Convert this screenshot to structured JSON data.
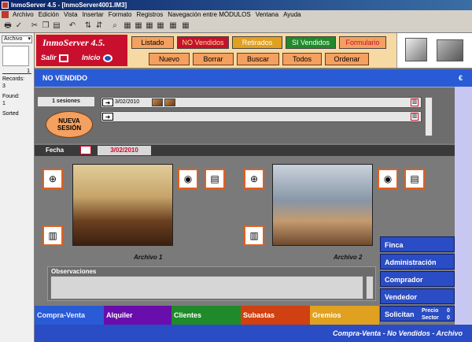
{
  "window": {
    "title": "InmoServer 4.5 - [InmoServer4001.IM3]"
  },
  "menu": [
    "Archivo",
    "Edición",
    "Vista",
    "Insertar",
    "Formato",
    "Registros",
    "Navegación entre MÓDULOS",
    "Ventana",
    "Ayuda"
  ],
  "status": {
    "layout_select": "Archivo",
    "record_number": "1",
    "records_label": "Records:",
    "records_value": "3",
    "found_label": "Found:",
    "found_value": "1",
    "sorted": "Sorted"
  },
  "logo": {
    "name": "InmoServer 4.5.",
    "salir": "Salir",
    "inicio": "Inicio"
  },
  "tabs": {
    "listado": "Listado",
    "no_vendidos": "NO Vendidos",
    "retirados": "Retirados",
    "si_vendidos": "SI Vendidos",
    "formulario": "Formulario"
  },
  "actions": {
    "nuevo": "Nuevo",
    "borrar": "Borrar",
    "buscar": "Buscar",
    "todos": "Todos",
    "ordenar": "Ordenar"
  },
  "section": {
    "title": "NO VENDIDO",
    "currency": "€"
  },
  "sessions": {
    "count_label": "1 sesiones",
    "new_label_1": "NUEVA",
    "new_label_2": "SESIÓN",
    "row1_date": "3/02/2010"
  },
  "fecha": {
    "label": "Fecha",
    "value": "3/02/2010"
  },
  "archivos": {
    "a1": "Archivo 1",
    "a2": "Archivo 2"
  },
  "observaciones": {
    "label": "Observaciones"
  },
  "side_buttons": {
    "finca": "Finca",
    "administracion": "Administración",
    "comprador": "Comprador",
    "vendedor": "Vendedor",
    "solicitan": "Solicitan",
    "precio_label": "Precio",
    "precio_value": "0",
    "sector_label": "Sector",
    "sector_value": "0"
  },
  "bottom_tabs": {
    "compra_venta": "Compra-Venta",
    "alquiler": "Alquiler",
    "clientes": "Clientes",
    "subastas": "Subastas",
    "gremios": "Gremios"
  },
  "footer": "Compra-Venta - No Vendidos - Archivo",
  "colors": {
    "brand_red": "#c8102e",
    "accent_blue": "#2a5bd7",
    "orange": "#f4a060"
  }
}
